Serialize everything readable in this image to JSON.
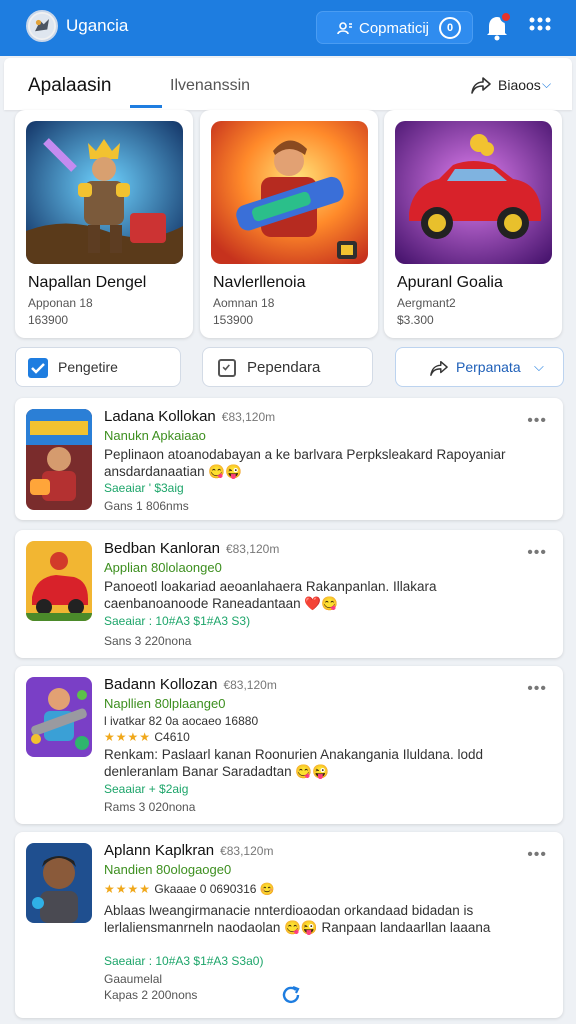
{
  "header": {
    "app_title": "Ugancia",
    "search_pill_text": "Copmaticij",
    "pill_badge": "0",
    "accent": "#1e7de0"
  },
  "tabs": {
    "active": "Apalaasin",
    "inactive": "Ilvenanssin",
    "share_label": "Biaoos"
  },
  "featured": [
    {
      "name": "Napallan Dengel",
      "sub": "Apponan 18",
      "price": "163900",
      "icon": "warrior-art"
    },
    {
      "name": "Navlerllenoia",
      "sub": "Aomnan 18",
      "price": "153900",
      "icon": "gunner-art"
    },
    {
      "name": "Apuranl Goalia",
      "sub": "Aergmant2",
      "price": "$3.300",
      "icon": "red-car-art"
    }
  ],
  "filters": [
    {
      "label": "Pengetire",
      "checked": true
    },
    {
      "label": "Pependara",
      "checked": false
    },
    {
      "label": "Perpanata",
      "dropdown": true
    }
  ],
  "items": [
    {
      "title": "Ladana Kollokan",
      "time": "€83,120m",
      "subtitle": "Nanukn Apkaiaao",
      "rating": "",
      "desc": "Peplinaon atoanodabayan a ke barlvara Perpksleakard Rapoyaniar ansdardanaatian 😋😜",
      "price": "Saeaiar ' $3aig",
      "meta": "Gans 1 806nms"
    },
    {
      "title": "Bedban Kanloran",
      "time": "€83,120m",
      "subtitle": "Applian 80lolaonge0",
      "rating": "",
      "desc": "Panoeotl loakariad aeoanlahaera Rakanpanlan. Illakara caenbanoanoode Raneadantaan ❤️😋",
      "price": "Saeaiar : 10#A3 $1#A3 S3)",
      "meta": "Sans 3 220nona"
    },
    {
      "title": "Badann Kollozan",
      "time": "€83,120m",
      "subtitle": "Napllien 80lplaange0",
      "rating_text": "l ivatkar 82 0a aocaeo 16880",
      "rating": "C4610",
      "desc": "Renkam: Paslaarl kanan Roonurien Anakangania Iluldana. lodd denleranlam Banar Saradadtan 😋😜",
      "price": "Seaaiar + $2aig",
      "meta": "Rams 3 020nona"
    },
    {
      "title": "Aplann Kaplkran",
      "time": "€83,120m",
      "subtitle": "Nandien 80ologaoge0",
      "rating": "Gkaaae 0 0690316",
      "desc": "Ablaas lweangirmanacie nnterdioaodan orkandaad bidadan is lerlaliensmanrneln naodaolan 😋😜 Ranpaan landaarllan laaana",
      "price": "Saeaiar : 10#A3 $1#A3 S3a0)",
      "meta": "Gaaumelal",
      "meta2": "Kapas 2 200nons"
    }
  ]
}
